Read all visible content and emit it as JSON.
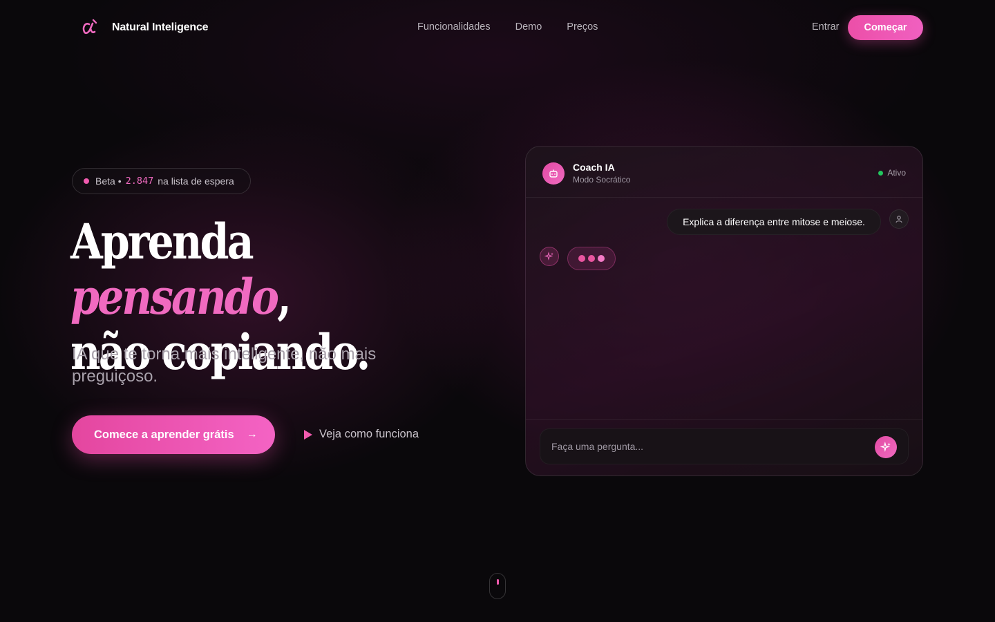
{
  "nav": {
    "brand": "Natural Inteligence",
    "links": [
      "Funcionalidades",
      "Demo",
      "Preços"
    ],
    "login": "Entrar",
    "start": "Começar"
  },
  "hero": {
    "badge": {
      "prefix": "Beta •",
      "count": "2.847",
      "suffix": "na lista de espera"
    },
    "headline": {
      "line1_start": "Aprenda",
      "line1_accent": "pensando",
      "line1_end": ",",
      "line2": "não copiando."
    },
    "subtitle": "IA que te torna mais inteligente, não mais preguiçoso.",
    "cta": "Comece a aprender grátis",
    "watch": "Veja como funciona"
  },
  "chat": {
    "name": "Coach IA",
    "mode": "Modo Socrático",
    "status": "Ativo",
    "user_message": "Explica a diferença entre mitose e meiose.",
    "input_placeholder": "Faça uma pergunta..."
  },
  "colors": {
    "accent": "#f06ac0",
    "status_green": "#22c55e"
  },
  "icons": [
    "brand-logo-icon",
    "robot-icon",
    "user-icon",
    "sparkles-icon",
    "arrow-right-icon",
    "play-icon",
    "mouse-scroll-icon"
  ]
}
